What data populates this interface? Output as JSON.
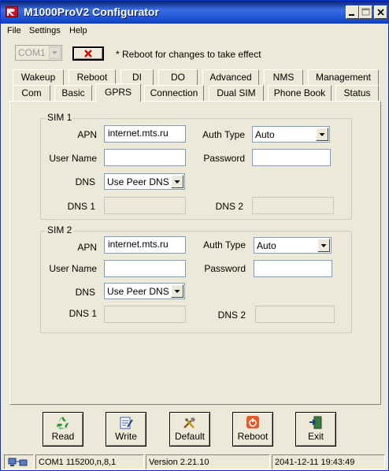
{
  "window": {
    "title": "M1000ProV2 Configurator"
  },
  "menu": {
    "file": "File",
    "settings": "Settings",
    "help": "Help"
  },
  "toolbar": {
    "com_port": "COM1",
    "reboot_note": "* Reboot for changes to take effect"
  },
  "tabs_row1": [
    "Wakeup",
    "Reboot",
    "DI",
    "DO",
    "Advanced",
    "NMS",
    "Management"
  ],
  "tabs_row2": [
    "Com",
    "Basic",
    "GPRS",
    "Connection",
    "Dual SIM",
    "Phone Book",
    "Status"
  ],
  "active_tab": "GPRS",
  "sim1": {
    "legend": "SIM 1",
    "apn_label": "APN",
    "apn_value": "internet.mts.ru",
    "user_label": "User Name",
    "user_value": "",
    "dns_label": "DNS",
    "dns_value": "Use Peer DNS",
    "dns1_label": "DNS 1",
    "dns2_label": "DNS 2",
    "auth_label": "Auth Type",
    "auth_value": "Auto",
    "password_label": "Password",
    "password_value": ""
  },
  "sim2": {
    "legend": "SIM 2",
    "apn_label": "APN",
    "apn_value": "internet.mts.ru",
    "user_label": "User Name",
    "user_value": "",
    "dns_label": "DNS",
    "dns_value": "Use Peer DNS",
    "dns1_label": "DNS 1",
    "dns2_label": "DNS 2",
    "auth_label": "Auth Type",
    "auth_value": "Auto",
    "password_label": "Password",
    "password_value": ""
  },
  "buttons": {
    "read": "Read",
    "write": "Write",
    "default": "Default",
    "reboot": "Reboot",
    "exit": "Exit"
  },
  "status": {
    "connection": "COM1 115200,n,8,1",
    "version": "Version 2.21.10",
    "datetime": "2041-12-11 19:43:49"
  },
  "icons": {
    "app": "app-logo-icon",
    "read": "recycle-icon",
    "write": "write-icon",
    "default": "tools-icon",
    "reboot": "power-icon",
    "exit": "exit-door-icon",
    "status": "network-icon"
  },
  "colors": {
    "title_bar": "#2457d6",
    "reboot_icon": "#e8592a",
    "close_x": "#d40000"
  }
}
